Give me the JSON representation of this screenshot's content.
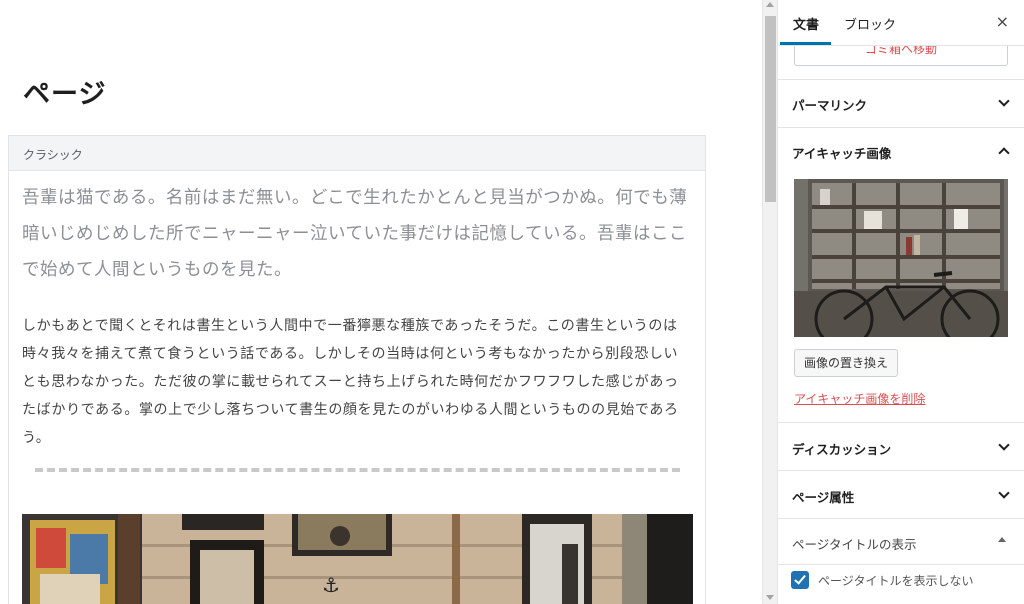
{
  "editor": {
    "page_title": "ページ",
    "block_label": "クラシック",
    "lead_paragraph": "吾輩は猫である。名前はまだ無い。どこで生れたかとんと見当がつかぬ。何でも薄暗いじめじめした所でニャーニャー泣いていた事だけは記憶している。吾輩はここで始めて人間というものを見た。",
    "body_paragraph": "しかもあとで聞くとそれは書生という人間中で一番獰悪な種族であったそうだ。この書生というのは時々我々を捕えて煮て食うという話である。しかしその当時は何という考もなかったから別段恐しいとも思わなかった。ただ彼の掌に載せられてスーと持ち上げられた時何だかフワフワした感じがあったばかりである。掌の上で少し落ちついて書生の顔を見たのがいわゆる人間というものの見始であろう。"
  },
  "sidebar": {
    "tabs": [
      {
        "label": "文書",
        "active": true
      },
      {
        "label": "ブロック",
        "active": false
      }
    ],
    "close_icon": "×",
    "trash_label": "ゴミ箱へ移動",
    "panels": {
      "permalink": "パーマリンク",
      "featured_image": "アイキャッチ画像",
      "discussion": "ディスカッション",
      "page_attributes": "ページ属性",
      "page_title_display": "ページタイトルの表示"
    },
    "replace_image_label": "画像の置き換え",
    "remove_image_label": "アイキャッチ画像を削除",
    "hide_title_checkbox": {
      "label": "ページタイトルを表示しない",
      "checked": true
    }
  },
  "colors": {
    "accent": "#0073aa",
    "danger": "#d94f4f",
    "checkbox": "#2271b1"
  }
}
